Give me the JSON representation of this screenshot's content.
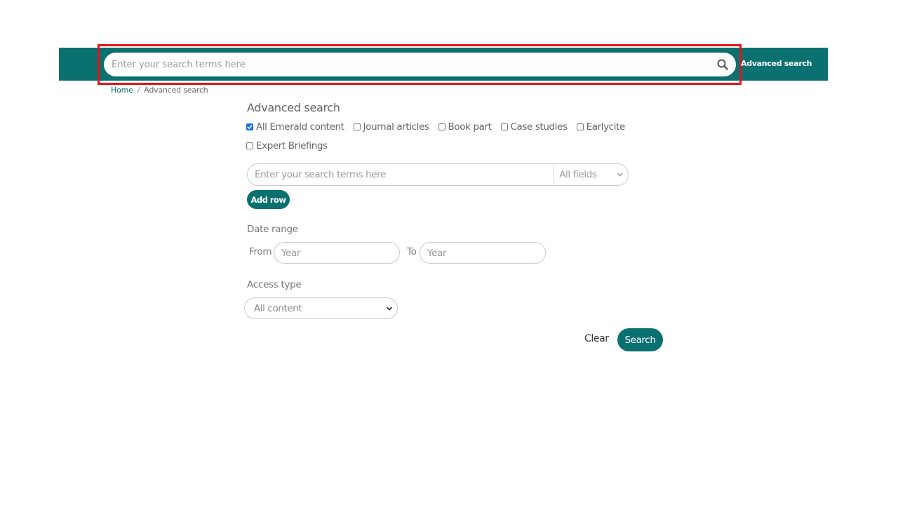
{
  "header": {
    "search_placeholder": "Enter your search terms here",
    "search_icon": "search-icon",
    "advanced_search_link": "Advanced search",
    "brand_color": "#0b7170",
    "highlight_color": "#e0161b"
  },
  "breadcrumb": {
    "items": [
      "Home",
      "Advanced search"
    ],
    "separator": "/"
  },
  "form": {
    "title": "Advanced search",
    "content_types": [
      {
        "label": "All Emerald content",
        "checked": true
      },
      {
        "label": "Journal articles",
        "checked": false
      },
      {
        "label": "Book part",
        "checked": false
      },
      {
        "label": "Case studies",
        "checked": false
      },
      {
        "label": "Earlycite",
        "checked": false
      },
      {
        "label": "Expert Briefings",
        "checked": false
      }
    ],
    "terms_placeholder": "Enter your search terms here",
    "field_select": "All fields",
    "add_row_label": "Add row",
    "date_range": {
      "label": "Date range",
      "from_label": "From",
      "to_label": "To",
      "from_placeholder": "Year",
      "to_placeholder": "Year"
    },
    "access_type": {
      "label": "Access type",
      "selected": "All content"
    },
    "clear_label": "Clear",
    "search_label": "Search"
  }
}
